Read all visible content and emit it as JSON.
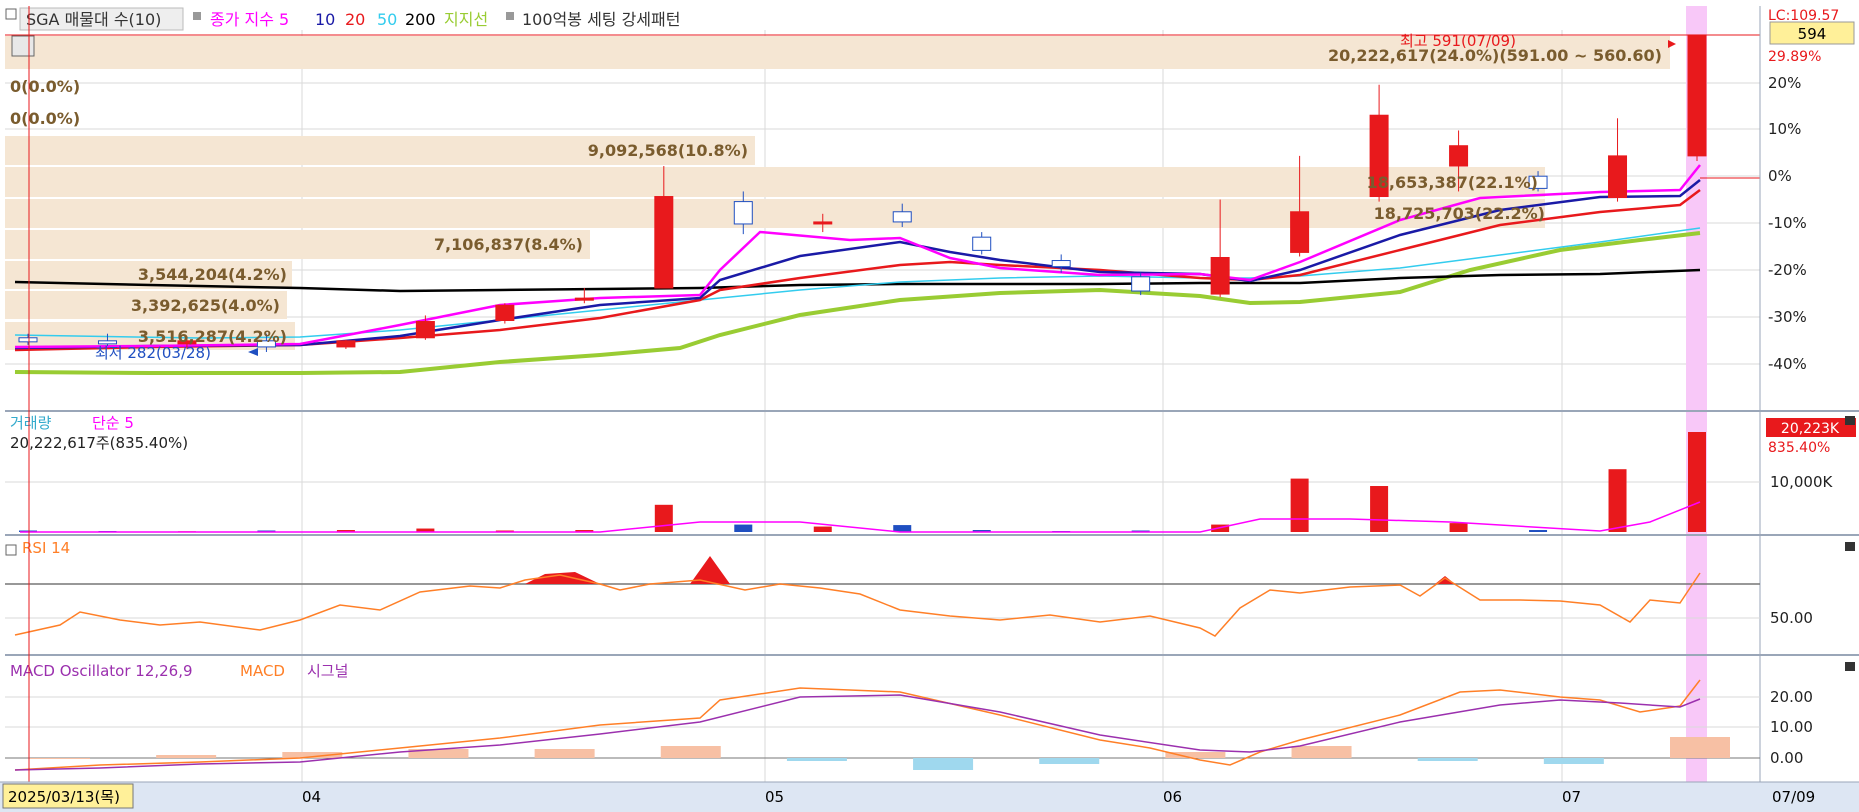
{
  "legend": {
    "prefix": "▫",
    "indicator": "SGA 매물대 수(10)",
    "ma_title": "종가 지수 5",
    "ma10": "10",
    "ma20": "20",
    "ma50": "50",
    "ma200": "200",
    "support": "지지선",
    "pattern": "100억봉 세팅 강세패턴"
  },
  "price_axis": {
    "lc_label": "LC:109.57",
    "last_price": "594",
    "change_label": "29.89%",
    "ticks": [
      "20%",
      "10%",
      "0%",
      "-10%",
      "-20%",
      "-30%",
      "-40%"
    ]
  },
  "volume_profile": [
    {
      "label": "20,222,617(24.0%)(591.00 ~ 560.60)",
      "pct": 24.0
    },
    {
      "label": "0(0.0%)",
      "pct": 0.0
    },
    {
      "label": "0(0.0%)",
      "pct": 0.0
    },
    {
      "label": "9,092,568(10.8%)",
      "pct": 10.8
    },
    {
      "label": "18,653,387(22.1%)",
      "pct": 22.1
    },
    {
      "label": "18,725,703(22.2%)",
      "pct": 22.2
    },
    {
      "label": "7,106,837(8.4%)",
      "pct": 8.4
    },
    {
      "label": "3,544,204(4.2%)",
      "pct": 4.2
    },
    {
      "label": "3,392,625(4.0%)",
      "pct": 4.0
    },
    {
      "label": "3,516,287(4.2%)",
      "pct": 4.2
    }
  ],
  "annotations": {
    "high": "최고 591(07/09)",
    "low": "최저 282(03/28)"
  },
  "volume_panel": {
    "title": "거래량",
    "ma": "단순 5",
    "value": "20,222,617주(835.40%)",
    "badge": "20,223K",
    "badge_pct": "835.40%",
    "tick": "10,000K"
  },
  "rsi_panel": {
    "title": "RSI 14",
    "tick": "50.00"
  },
  "macd_panel": {
    "title": "MACD Oscillator 12,26,9",
    "macd": "MACD",
    "signal": "시그널",
    "ticks": [
      "20.00",
      "10.00",
      "0.00"
    ]
  },
  "x_axis": {
    "start_date": "2025/03/13(목)",
    "months": [
      "04",
      "05",
      "06",
      "07"
    ],
    "end_date": "07/09"
  },
  "colors": {
    "up": "#e8191c",
    "down": "#1f4fc1",
    "ma5": "#ff00ff",
    "ma10": "#1a1aa6",
    "ma20": "#e8191c",
    "ma50": "#33ccee",
    "ma200": "#000000",
    "support": "#99cc33",
    "profile": "#f5e6d3",
    "highlight": "#f8c8f8"
  },
  "chart_data": {
    "type": "candlestick",
    "date_range": [
      "2025-03-13",
      "2025-07-09"
    ],
    "price_series": [
      {
        "date": "03/13",
        "o": 296,
        "h": 300,
        "l": 289,
        "c": 292
      },
      {
        "date": "03/19",
        "o": 293,
        "h": 300,
        "l": 288,
        "c": 290
      },
      {
        "date": "03/24",
        "o": 290,
        "h": 296,
        "l": 285,
        "c": 293
      },
      {
        "date": "03/28",
        "o": 293,
        "h": 300,
        "l": 282,
        "c": 287
      },
      {
        "date": "04/07",
        "o": 287,
        "h": 294,
        "l": 285,
        "c": 293
      },
      {
        "date": "04/14",
        "o": 296,
        "h": 318,
        "l": 294,
        "c": 312
      },
      {
        "date": "04/21",
        "o": 313,
        "h": 330,
        "l": 310,
        "c": 328
      },
      {
        "date": "04/28",
        "o": 333,
        "h": 345,
        "l": 330,
        "c": 335
      },
      {
        "date": "05/02",
        "o": 345,
        "h": 465,
        "l": 345,
        "c": 435
      },
      {
        "date": "05/08",
        "o": 430,
        "h": 440,
        "l": 398,
        "c": 408
      },
      {
        "date": "05/15",
        "o": 408,
        "h": 418,
        "l": 400,
        "c": 410
      },
      {
        "date": "05/22",
        "o": 420,
        "h": 428,
        "l": 405,
        "c": 410
      },
      {
        "date": "05/29",
        "o": 395,
        "h": 400,
        "l": 378,
        "c": 382
      },
      {
        "date": "06/05",
        "o": 372,
        "h": 378,
        "l": 360,
        "c": 366
      },
      {
        "date": "06/10",
        "o": 356,
        "h": 360,
        "l": 338,
        "c": 342
      },
      {
        "date": "06/16",
        "o": 339,
        "h": 432,
        "l": 336,
        "c": 375
      },
      {
        "date": "06/19",
        "o": 380,
        "h": 475,
        "l": 376,
        "c": 420
      },
      {
        "date": "06/25",
        "o": 435,
        "h": 545,
        "l": 430,
        "c": 515
      },
      {
        "date": "06/27",
        "o": 465,
        "h": 500,
        "l": 440,
        "c": 485
      },
      {
        "date": "07/02",
        "o": 455,
        "h": 460,
        "l": 440,
        "c": 443
      },
      {
        "date": "07/07",
        "o": 434,
        "h": 512,
        "l": 430,
        "c": 475
      },
      {
        "date": "07/09",
        "o": 475,
        "h": 591,
        "l": 470,
        "c": 594
      }
    ],
    "volume_k": [
      300,
      200,
      150,
      300,
      400,
      700,
      300,
      400,
      5500,
      1500,
      1100,
      1400,
      400,
      200,
      300,
      1500,
      10800,
      9300,
      1800,
      400,
      12700,
      20223
    ],
    "rsi": [
      {
        "date": "03/13",
        "v": 45
      },
      {
        "date": "04/01",
        "v": 47
      },
      {
        "date": "04/14",
        "v": 58
      },
      {
        "date": "04/28",
        "v": 66
      },
      {
        "date": "05/02",
        "v": 67
      },
      {
        "date": "05/15",
        "v": 55
      },
      {
        "date": "05/29",
        "v": 52
      },
      {
        "date": "06/10",
        "v": 44
      },
      {
        "date": "06/19",
        "v": 60
      },
      {
        "date": "06/25",
        "v": 66
      },
      {
        "date": "07/02",
        "v": 56
      },
      {
        "date": "07/09",
        "v": 68
      }
    ],
    "rsi_reference": 60,
    "macd": {
      "macd": [
        -2,
        0,
        4,
        8,
        12,
        22,
        20,
        10,
        0,
        12,
        22,
        18,
        15,
        26
      ],
      "signal": [
        -2,
        -1,
        2,
        5,
        9,
        18,
        21,
        14,
        2,
        10,
        18,
        19,
        17,
        19
      ]
    },
    "y_axis_pct_range": [
      -45,
      30
    ],
    "grid": true
  }
}
